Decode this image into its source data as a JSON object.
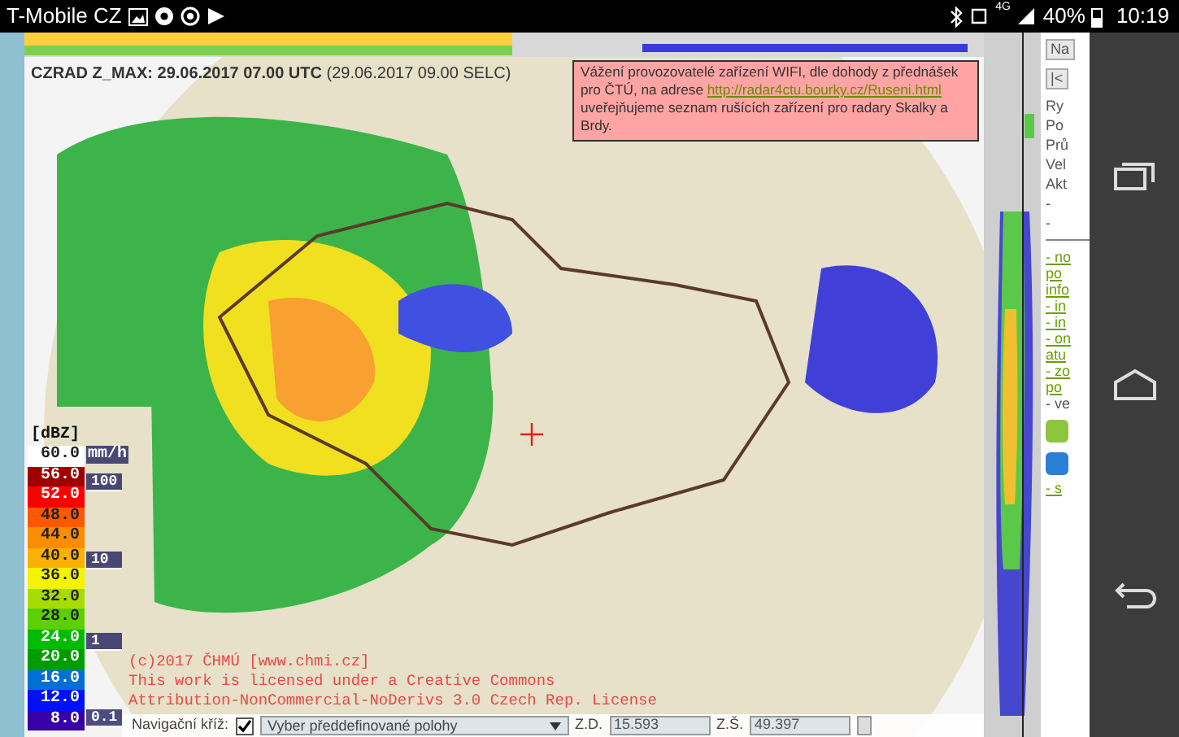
{
  "status_bar": {
    "carrier": "T-Mobile CZ",
    "network": "4G",
    "battery": "40%",
    "time": "10:19"
  },
  "map": {
    "title": "**CZRAD Z_MAX: 29.06.2017 07.00 UTC** (29.06.2017 09.00 SELC)",
    "notice": {
      "text_before": "Vážení provozovatelé zařízení WIFI, dle dohody z přednášek pro ČTÚ, na adrese",
      "link": "http://radar4ctu.bourky.cz/Ruseni.html",
      "text_after": "uveřejňujeme seznam rušících zařízení pro radary Skalky a Brdy."
    },
    "legend": {
      "unit": "[dBZ]",
      "rain_unit": "mm/h",
      "levels": [
        {
          "label": "60.0",
          "color": "#ffffff"
        },
        {
          "label": "56.0",
          "color": "#a00000"
        },
        {
          "label": "52.0",
          "color": "#fc0000"
        },
        {
          "label": "48.0",
          "color": "#fc5800"
        },
        {
          "label": "44.0",
          "color": "#fc8c00"
        },
        {
          "label": "40.0",
          "color": "#fcb000"
        },
        {
          "label": "36.0",
          "color": "#f4f400"
        },
        {
          "label": "32.0",
          "color": "#a8dc00"
        },
        {
          "label": "28.0",
          "color": "#5cd000"
        },
        {
          "label": "24.0",
          "color": "#00bc00"
        },
        {
          "label": "20.0",
          "color": "#009c00"
        },
        {
          "label": "16.0",
          "color": "#0070d8"
        },
        {
          "label": "12.0",
          "color": "#0010f8"
        },
        {
          "label": "8.0",
          "color": "#3800a8"
        }
      ],
      "rain_marks": [
        "100",
        "10",
        "1",
        "0.1"
      ]
    },
    "copyright": [
      "(c)2017 ČHMÚ [www.chmi.cz]",
      "This work is licensed under a Creative Commons",
      "Attribution-NonCommercial-NoDerivs 3.0 Czech Rep. License"
    ]
  },
  "controls": {
    "crosshair_label": "Navigační kříž:",
    "crosshair_checked": true,
    "preset_select": "Vyber předdefinované polohy",
    "lon_label": "Z.D.",
    "lon_value": "15.593",
    "lat_label": "Z.Š.",
    "lat_value": "49.397"
  },
  "side_panel": {
    "items": [
      {
        "kind": "button",
        "text": "Na"
      },
      {
        "kind": "button",
        "text": "|<"
      },
      {
        "kind": "text",
        "text": "Ry"
      },
      {
        "kind": "text",
        "text": "Po"
      },
      {
        "kind": "text",
        "text": "Prů"
      },
      {
        "kind": "text",
        "text": "Vel"
      },
      {
        "kind": "text",
        "text": "Akt"
      },
      {
        "kind": "text",
        "text": "-"
      },
      {
        "kind": "text",
        "text": "-"
      },
      {
        "kind": "rule"
      },
      {
        "kind": "link",
        "text": "- no"
      },
      {
        "kind": "link",
        "text": "po"
      },
      {
        "kind": "link",
        "text": "info"
      },
      {
        "kind": "link",
        "text": "- in"
      },
      {
        "kind": "link",
        "text": "- in"
      },
      {
        "kind": "link",
        "text": "- on"
      },
      {
        "kind": "link",
        "text": "atu"
      },
      {
        "kind": "link",
        "text": "- zo"
      },
      {
        "kind": "link",
        "text": "po"
      },
      {
        "kind": "text",
        "text": "- ve"
      },
      {
        "kind": "icon",
        "color": "#8cc63c"
      },
      {
        "kind": "icon",
        "color": "#2a7fd6"
      },
      {
        "kind": "link",
        "text": "- s"
      }
    ]
  }
}
